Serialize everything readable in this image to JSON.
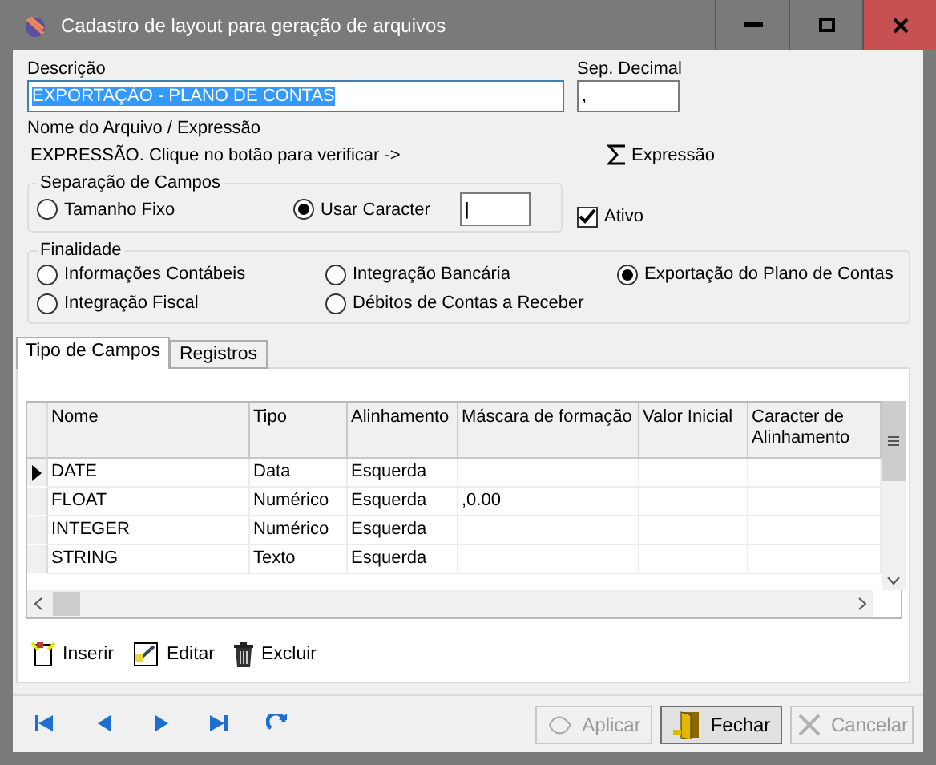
{
  "window": {
    "title": "Cadastro de layout para geração de arquivos"
  },
  "descricao": {
    "label": "Descrição",
    "value": "EXPORTAÇÃO - PLANO DE CONTAS",
    "selected": true
  },
  "sep_decimal": {
    "label": "Sep. Decimal",
    "value": ","
  },
  "nome_arquivo": {
    "label": "Nome do Arquivo / Expressão",
    "text": "EXPRESSÃO. Clique no botão para verificar ->"
  },
  "expressao_button": {
    "label": "Expressão"
  },
  "separacao": {
    "title": "Separação de Campos",
    "options": [
      {
        "label": "Tamanho Fixo",
        "selected": false
      },
      {
        "label": "Usar Caracter",
        "selected": true
      }
    ],
    "caracter_value": "|"
  },
  "ativo": {
    "label": "Ativo",
    "checked": true
  },
  "finalidade": {
    "title": "Finalidade",
    "options": [
      {
        "label": "Informações Contábeis",
        "selected": false
      },
      {
        "label": "Integração Bancária",
        "selected": false
      },
      {
        "label": "Exportação do Plano de Contas",
        "selected": true
      },
      {
        "label": "Integração Fiscal",
        "selected": false
      },
      {
        "label": "Débitos de Contas a Receber",
        "selected": false
      }
    ]
  },
  "tabs": [
    {
      "label": "Tipo de Campos",
      "selected": true
    },
    {
      "label": "Registros",
      "selected": false
    }
  ],
  "table": {
    "columns": [
      "Nome",
      "Tipo",
      "Alinhamento",
      "Máscara de formação",
      "Valor Inicial",
      "Caracter de Alinhamento"
    ],
    "rows": [
      {
        "current": true,
        "cells": [
          "DATE",
          "Data",
          "Esquerda",
          "",
          "",
          ""
        ]
      },
      {
        "current": false,
        "cells": [
          "FLOAT",
          "Numérico",
          "Esquerda",
          ",0.00",
          "",
          ""
        ]
      },
      {
        "current": false,
        "cells": [
          "INTEGER",
          "Numérico",
          "Esquerda",
          "",
          "",
          ""
        ]
      },
      {
        "current": false,
        "cells": [
          "STRING",
          "Texto",
          "Esquerda",
          "",
          "",
          ""
        ]
      }
    ]
  },
  "actions": [
    {
      "kind": "insert",
      "label": "Inserir"
    },
    {
      "kind": "edit",
      "label": "Editar"
    },
    {
      "kind": "delete",
      "label": "Excluir"
    }
  ],
  "buttons": [
    {
      "kind": "apply",
      "label": "Aplicar",
      "disabled": true
    },
    {
      "kind": "close",
      "label": "Fechar",
      "disabled": false
    },
    {
      "kind": "cancel",
      "label": "Cancelar",
      "disabled": true
    }
  ]
}
